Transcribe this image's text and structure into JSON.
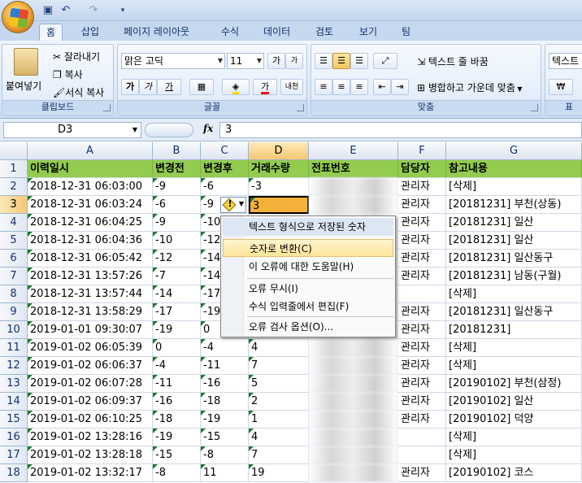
{
  "tabs": [
    "홈",
    "삽입",
    "페이지 레이아웃",
    "수식",
    "데이터",
    "검토",
    "보기",
    "팀"
  ],
  "clipboard": {
    "paste": "붙여넣기",
    "cut": "잘라내기",
    "copy": "복사",
    "format_painter": "서식 복사",
    "label": "클립보드"
  },
  "font": {
    "name": "맑은 고딕",
    "size": "11",
    "grow_glyph": "가",
    "shrink_glyph": "가",
    "bold_glyph": "가",
    "italic_glyph": "가",
    "underline_glyph": "가",
    "font_color_glyph": "가",
    "phonetic_glyph": "내천",
    "label": "글꼴"
  },
  "alignment": {
    "wrap_text": "텍스트 줄 바꿈",
    "merge_center": "병합하고 가운데 맞춤",
    "label": "맞춤"
  },
  "number": {
    "format": "텍스트",
    "currency_glyph": "₩",
    "label": "표"
  },
  "formula_bar": {
    "name_box": "D3",
    "fx": "fx",
    "value": "3"
  },
  "columns": [
    "A",
    "B",
    "C",
    "D",
    "E",
    "F",
    "G"
  ],
  "header_row": [
    "이력일시",
    "변경전",
    "변경후",
    "거래수량",
    "전표번호",
    "담당자",
    "참고내용"
  ],
  "rows": [
    {
      "n": "2",
      "a": "2018-12-31 06:03:00",
      "b": "-9",
      "c": "-6",
      "d": "-3",
      "f": "관리자",
      "g": "[삭제]"
    },
    {
      "n": "3",
      "a": "2018-12-31 06:03:24",
      "b": "-6",
      "c": "-9",
      "d": "3",
      "f": "관리자",
      "g": "[20181231] 부천(상동)"
    },
    {
      "n": "4",
      "a": "2018-12-31 06:04:25",
      "b": "-9",
      "c": "-10",
      "d": "",
      "f": "관리자",
      "g": "[20181231] 일산"
    },
    {
      "n": "5",
      "a": "2018-12-31 06:04:36",
      "b": "-10",
      "c": "-12",
      "d": "",
      "f": "관리자",
      "g": "[20181231] 일산"
    },
    {
      "n": "6",
      "a": "2018-12-31 06:05:42",
      "b": "-12",
      "c": "-14",
      "d": "",
      "f": "관리자",
      "g": "[20181231] 일산동구"
    },
    {
      "n": "7",
      "a": "2018-12-31 13:57:26",
      "b": "-7",
      "c": "-14",
      "d": "",
      "f": "관리자",
      "g": "[20181231] 남동(구월)"
    },
    {
      "n": "8",
      "a": "2018-12-31 13:57:44",
      "b": "-14",
      "c": "-17",
      "d": "",
      "f": "",
      "g": "[삭제]"
    },
    {
      "n": "9",
      "a": "2018-12-31 13:58:29",
      "b": "-17",
      "c": "-19",
      "d": "",
      "f": "관리자",
      "g": "[20181231] 일산동구"
    },
    {
      "n": "10",
      "a": "2019-01-01 09:30:07",
      "b": "-19",
      "c": "0",
      "d": "",
      "f": "관리자",
      "g": "[20181231]"
    },
    {
      "n": "11",
      "a": "2019-01-02 06:05:39",
      "b": "0",
      "c": "-4",
      "d": "4",
      "f": "관리자",
      "g": "[삭제]"
    },
    {
      "n": "12",
      "a": "2019-01-02 06:06:37",
      "b": "-4",
      "c": "-11",
      "d": "7",
      "f": "관리자",
      "g": "[삭제]"
    },
    {
      "n": "13",
      "a": "2019-01-02 06:07:28",
      "b": "-11",
      "c": "-16",
      "d": "5",
      "f": "관리자",
      "g": "[20190102] 부천(삼정)"
    },
    {
      "n": "14",
      "a": "2019-01-02 06:09:37",
      "b": "-16",
      "c": "-18",
      "d": "2",
      "f": "관리자",
      "g": "[20190102] 일산"
    },
    {
      "n": "15",
      "a": "2019-01-02 06:10:25",
      "b": "-18",
      "c": "-19",
      "d": "1",
      "f": "관리자",
      "g": "[20190102] 덕양"
    },
    {
      "n": "16",
      "a": "2019-01-02 13:28:16",
      "b": "-19",
      "c": "-15",
      "d": "4",
      "f": "",
      "g": "[삭제]"
    },
    {
      "n": "17",
      "a": "2019-01-02 13:28:18",
      "b": "-15",
      "c": "-8",
      "d": "7",
      "f": "",
      "g": "[삭제]"
    },
    {
      "n": "18",
      "a": "2019-01-02 13:32:17",
      "b": "-8",
      "c": "11",
      "d": "19",
      "f": "관리자",
      "g": "[20190102] 코스"
    }
  ],
  "error_menu": {
    "title": "텍스트 형식으로 저장된 숫자",
    "convert": "숫자로 변환(C)",
    "help": "이 오류에 대한 도움말(H)",
    "ignore": "오류 무시(I)",
    "edit_in_bar": "수식 입력줄에서 편집(F)",
    "options": "오류 검사 옵션(O)..."
  },
  "colors": {
    "header_fill": "#93cc4e",
    "active_cell_fill": "#f3b13a",
    "error_indicator": "#1e7a2e"
  },
  "icons": [
    "office-button-icon",
    "save-icon",
    "undo-icon",
    "redo-icon",
    "paste-icon",
    "scissors-icon",
    "copy-icon",
    "brush-icon",
    "warning-diamond-icon"
  ]
}
